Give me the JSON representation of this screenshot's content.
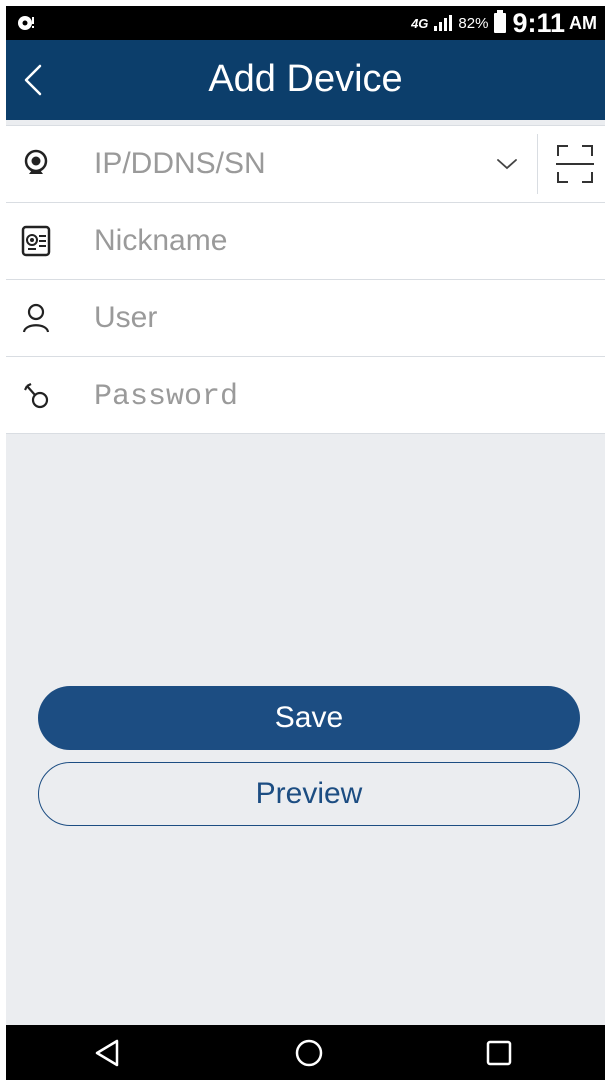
{
  "status_bar": {
    "network": "4G",
    "battery_percent": "82%",
    "time": "9:11",
    "am_pm": "AM",
    "icons": [
      "notification-icon",
      "signal-icon",
      "battery-icon"
    ]
  },
  "header": {
    "title": "Add Device",
    "back_icon": "chevron-left-icon"
  },
  "form": {
    "address": {
      "placeholder": "IP/DDNS/SN",
      "value": "",
      "icon": "webcam-icon",
      "dropdown_icon": "chevron-down-icon",
      "scan_icon": "scan-icon"
    },
    "nickname": {
      "placeholder": "Nickname",
      "value": "",
      "icon": "id-card-icon"
    },
    "user": {
      "placeholder": "User",
      "value": "",
      "icon": "person-icon"
    },
    "password": {
      "placeholder": "Password",
      "value": "",
      "icon": "key-icon"
    }
  },
  "buttons": {
    "save": "Save",
    "preview": "Preview"
  },
  "nav_bar": {
    "icons": [
      "back-triangle-icon",
      "home-circle-icon",
      "recents-square-icon"
    ]
  },
  "colors": {
    "header_bg": "#0c3e6b",
    "primary_button": "#1c4d82",
    "page_bg": "#ebedf0",
    "status_bar_bg": "#000000"
  }
}
